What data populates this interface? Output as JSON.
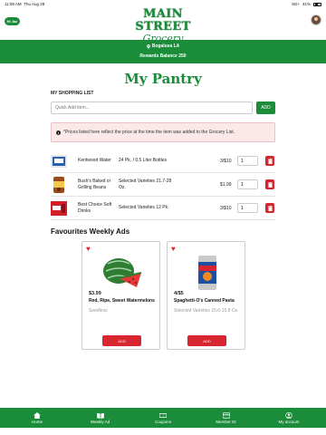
{
  "status": {
    "time": "11:09 AM",
    "date": "Thu Aug 28",
    "signal": "5G+",
    "battery": "41%"
  },
  "header": {
    "greeting": "Hi Jac",
    "logo_main": "MAIN STREET",
    "logo_sub": "Grocery"
  },
  "store": {
    "location": "Bogalusa LA",
    "rewards": "Rewards Balance 250"
  },
  "page_title": "My Pantry",
  "shopping_list": {
    "label": "MY SHOPPING LIST",
    "placeholder": "Quick Add item...",
    "add_label": "ADD",
    "notice": "*Prices listed here reflect the price at the time the item was added to the Grocery List.",
    "items": [
      {
        "name": "Kentwood Water",
        "variety": "24 Pk. / 0.5 Liter Bottles",
        "price": "3/$10",
        "qty": "1"
      },
      {
        "name": "Bush's Baked or Grilling Beans",
        "variety": "Selected Varieties 21.7-28 Oz.",
        "price": "$1.99",
        "qty": "1"
      },
      {
        "name": "Best Choice Soft Drinks",
        "variety": "Selected Varieties 12 Pk.",
        "price": "3/$10",
        "qty": "1"
      }
    ]
  },
  "favourites": {
    "title": "Favourites Weekly Ads",
    "ads": [
      {
        "price": "$3.99",
        "name": "Red, Ripe, Sweet Watermelons",
        "desc": "Seedless",
        "add_label": "ADD"
      },
      {
        "price": "4/$5",
        "name": "Spaghetti-O's Canned Pasta",
        "desc": "Selected Varieties 15.6-15.8 Oz.",
        "add_label": "ADD"
      }
    ]
  },
  "tabs": [
    {
      "label": "Home",
      "icon": "home-icon"
    },
    {
      "label": "Weekly Ad",
      "icon": "book-icon"
    },
    {
      "label": "Coupons",
      "icon": "coupon-icon"
    },
    {
      "label": "Member ID",
      "icon": "card-icon"
    },
    {
      "label": "My account",
      "icon": "user-icon"
    }
  ],
  "colors": {
    "brand_green": "#1a8c3a",
    "danger_red": "#d7262f"
  }
}
